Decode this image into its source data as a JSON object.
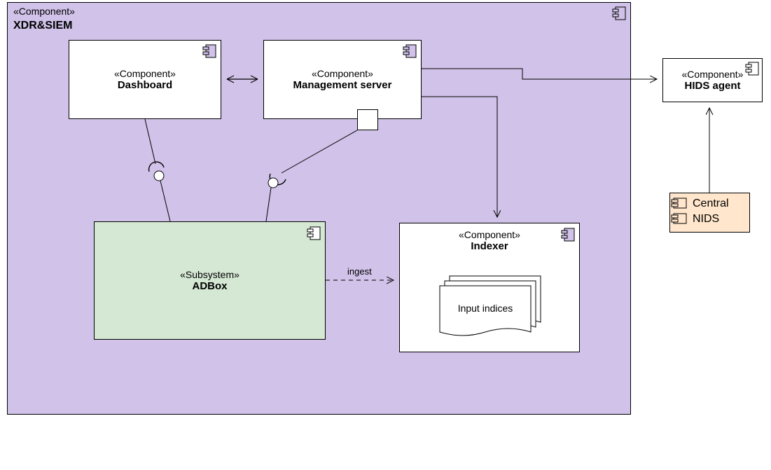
{
  "outer": {
    "stereotype": "«Component»",
    "name": "XDR&SIEM"
  },
  "dashboard": {
    "stereotype": "«Component»",
    "name": "Dashboard"
  },
  "mgmt": {
    "stereotype": "«Component»",
    "name": "Management server"
  },
  "indexer": {
    "stereotype": "«Component»",
    "name": "Indexer",
    "inner_label": "Input indices"
  },
  "adbox": {
    "stereotype": "«Subsystem»",
    "name": "ADBox"
  },
  "hids": {
    "stereotype": "«Component»",
    "name": "HIDS agent"
  },
  "nids": {
    "line1": "Central",
    "line2": "NIDS"
  },
  "edge": {
    "ingest": "ingest"
  }
}
